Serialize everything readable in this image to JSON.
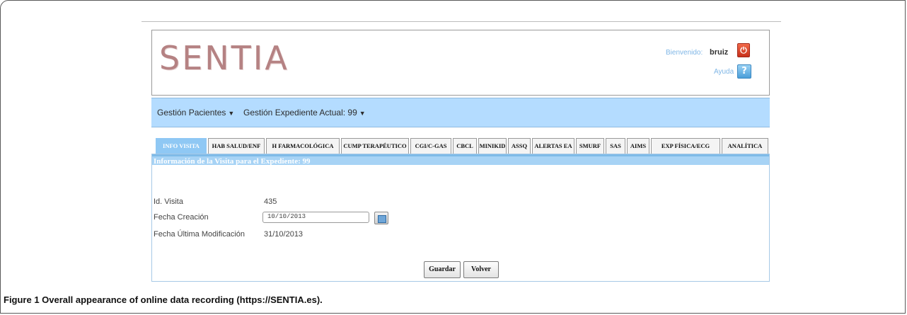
{
  "header": {
    "logo_text": "SENTIA",
    "welcome_label": "Bienvenido:",
    "user_name": "bruiz",
    "logout_icon": "power-icon",
    "help_label": "Ayuda",
    "help_icon": "question-icon"
  },
  "menu": {
    "items": [
      {
        "label": "Gestión Pacientes"
      },
      {
        "label": "Gestión Expediente Actual: 99"
      }
    ]
  },
  "tabs": [
    {
      "label": "INFO VISITA",
      "active": true
    },
    {
      "label": "HAB SALUD/ENF"
    },
    {
      "label": "H FARMACOLÓGICA"
    },
    {
      "label": "CUMP TERAPÉUTICO"
    },
    {
      "label": "CGI/C-GAS"
    },
    {
      "label": "CBCL"
    },
    {
      "label": "MINIKID"
    },
    {
      "label": "ASSQ"
    },
    {
      "label": "ALERTAS EA"
    },
    {
      "label": "SMURF"
    },
    {
      "label": "SAS"
    },
    {
      "label": "AIMS"
    },
    {
      "label": "EXP FÍSICA/ECG"
    },
    {
      "label": "ANALÍTICA"
    }
  ],
  "section": {
    "title": "Información de la Visita para el Expediente: 99"
  },
  "fields": {
    "visit_id_label": "Id. Visita",
    "visit_id_value": "435",
    "creation_date_label": "Fecha Creación",
    "creation_date_value": "10/10/2013",
    "last_modified_label": "Fecha Última Modificación",
    "last_modified_value": "31/10/2013"
  },
  "buttons": {
    "save_label": "Guardar",
    "back_label": "Volver"
  },
  "caption": {
    "bold": "Figure 1 Overall appearance of online data recording (https://SENTIA.es)."
  },
  "colors": {
    "menubar": "#b4dcff",
    "active_tab": "#8fc8f4",
    "logo": "#b58283"
  }
}
